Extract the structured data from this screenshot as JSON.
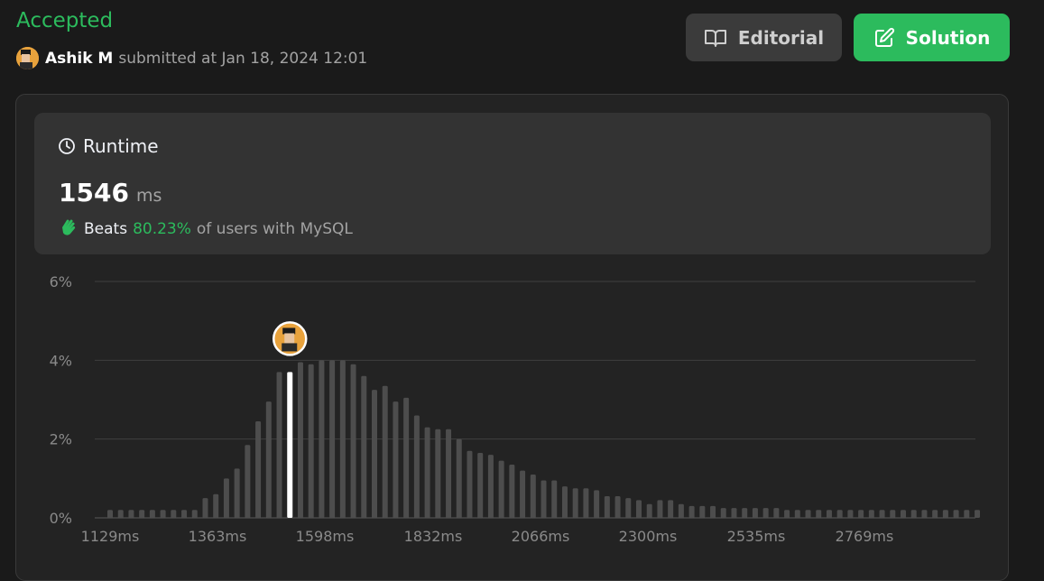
{
  "submission": {
    "status": "Accepted",
    "author": "Ashik M",
    "submitted_text": "submitted at Jan 18, 2024 12:01"
  },
  "buttons": {
    "editorial": "Editorial",
    "solution": "Solution"
  },
  "runtime": {
    "title": "Runtime",
    "value": "1546",
    "unit": "ms",
    "beats_label": "Beats",
    "beats_percent": "80.23%",
    "beats_suffix": "of users with MySQL"
  },
  "colors": {
    "accent_green": "#2cbb5d",
    "bar": "#4d4d4d",
    "highlight_bar": "#ffffff"
  },
  "icons": {
    "editorial": "book-open-icon",
    "solution": "edit-icon",
    "runtime": "clock-icon",
    "beats": "clapping-hands-icon"
  },
  "chart_data": {
    "type": "bar",
    "x_tick_labels": [
      "1129ms",
      "1363ms",
      "1598ms",
      "1832ms",
      "2066ms",
      "2300ms",
      "2535ms",
      "2769ms"
    ],
    "y_tick_labels": [
      "6%",
      "4%",
      "2%",
      "0%"
    ],
    "ylim": [
      0,
      6
    ],
    "highlight_index": 17,
    "grid": true,
    "values": [
      0.2,
      0.2,
      0.2,
      0.2,
      0.2,
      0.2,
      0.2,
      0.2,
      0.2,
      0.5,
      0.6,
      1.0,
      1.25,
      1.85,
      2.45,
      2.95,
      3.7,
      3.7,
      3.95,
      3.9,
      4.0,
      4.0,
      4.0,
      3.9,
      3.6,
      3.25,
      3.35,
      2.95,
      3.05,
      2.6,
      2.3,
      2.25,
      2.25,
      2.0,
      1.7,
      1.65,
      1.6,
      1.45,
      1.35,
      1.2,
      1.1,
      0.95,
      0.95,
      0.8,
      0.75,
      0.75,
      0.7,
      0.55,
      0.55,
      0.5,
      0.45,
      0.35,
      0.45,
      0.45,
      0.35,
      0.3,
      0.3,
      0.3,
      0.25,
      0.25,
      0.25,
      0.25,
      0.25,
      0.25,
      0.2,
      0.2,
      0.2,
      0.2,
      0.2,
      0.2,
      0.2,
      0.2,
      0.2,
      0.2,
      0.2,
      0.2,
      0.2,
      0.2,
      0.2,
      0.2,
      0.2,
      0.2,
      0.2
    ]
  }
}
